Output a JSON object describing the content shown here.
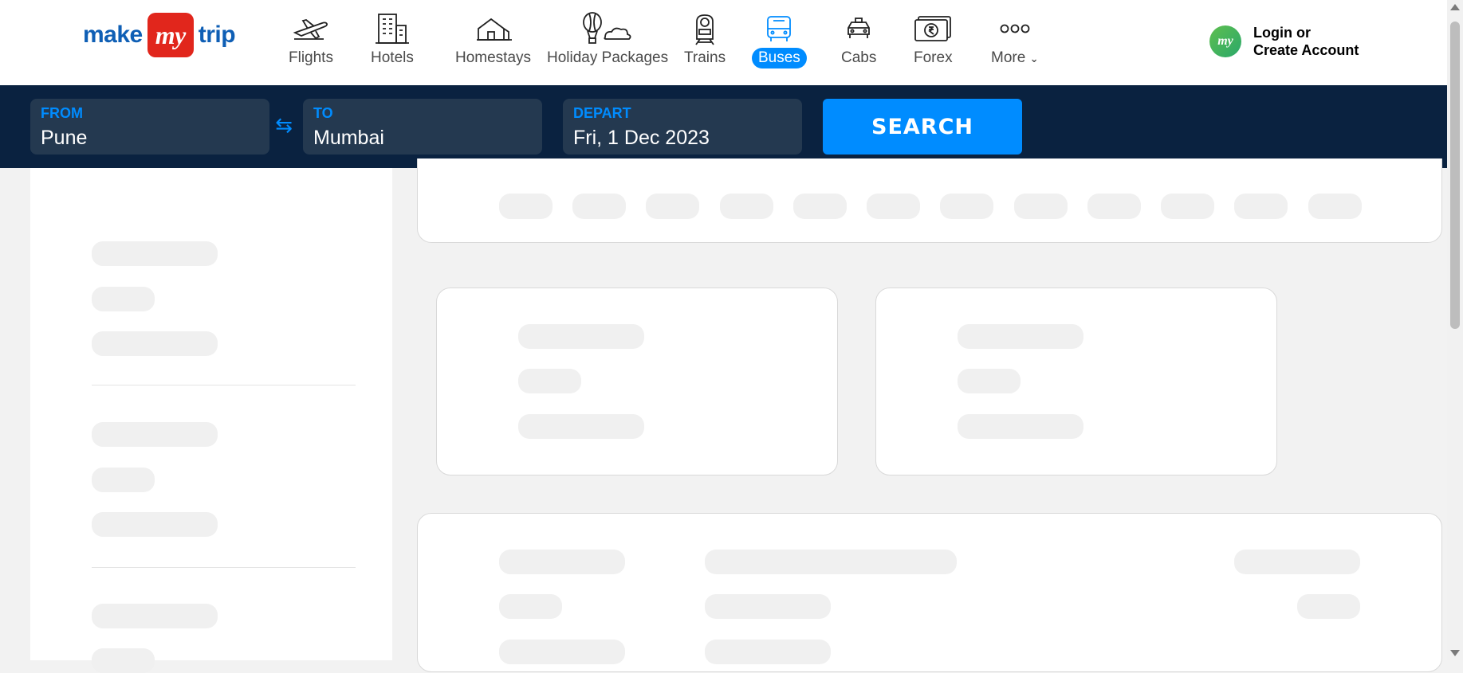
{
  "brand": {
    "logo_left": "make",
    "logo_badge": "my",
    "logo_right": "trip",
    "accent_color": "#008cff",
    "header_dark": "#0a2240"
  },
  "nav": {
    "items": [
      {
        "label": "Flights",
        "icon": "airplane-icon"
      },
      {
        "label": "Hotels",
        "icon": "building-icon"
      },
      {
        "label": "Homestays",
        "icon": "house-icon"
      },
      {
        "label": "Holiday Packages",
        "icon": "balloon-icon"
      },
      {
        "label": "Trains",
        "icon": "train-icon"
      },
      {
        "label": "Buses",
        "icon": "bus-icon",
        "active": true
      },
      {
        "label": "Cabs",
        "icon": "car-icon"
      },
      {
        "label": "Forex",
        "icon": "rupee-note-icon"
      },
      {
        "label": "More",
        "icon": "more-dots-icon"
      }
    ]
  },
  "account": {
    "avatar_text": "my",
    "line1": "Login or",
    "line2": "Create Account"
  },
  "search": {
    "from_label": "FROM",
    "from_value": "Pune",
    "to_label": "TO",
    "to_value": "Mumbai",
    "depart_label": "DEPART",
    "depart_value": "Fri, 1 Dec 2023",
    "button_label": "SEARCH",
    "swap_icon": "swap-arrows-icon"
  }
}
